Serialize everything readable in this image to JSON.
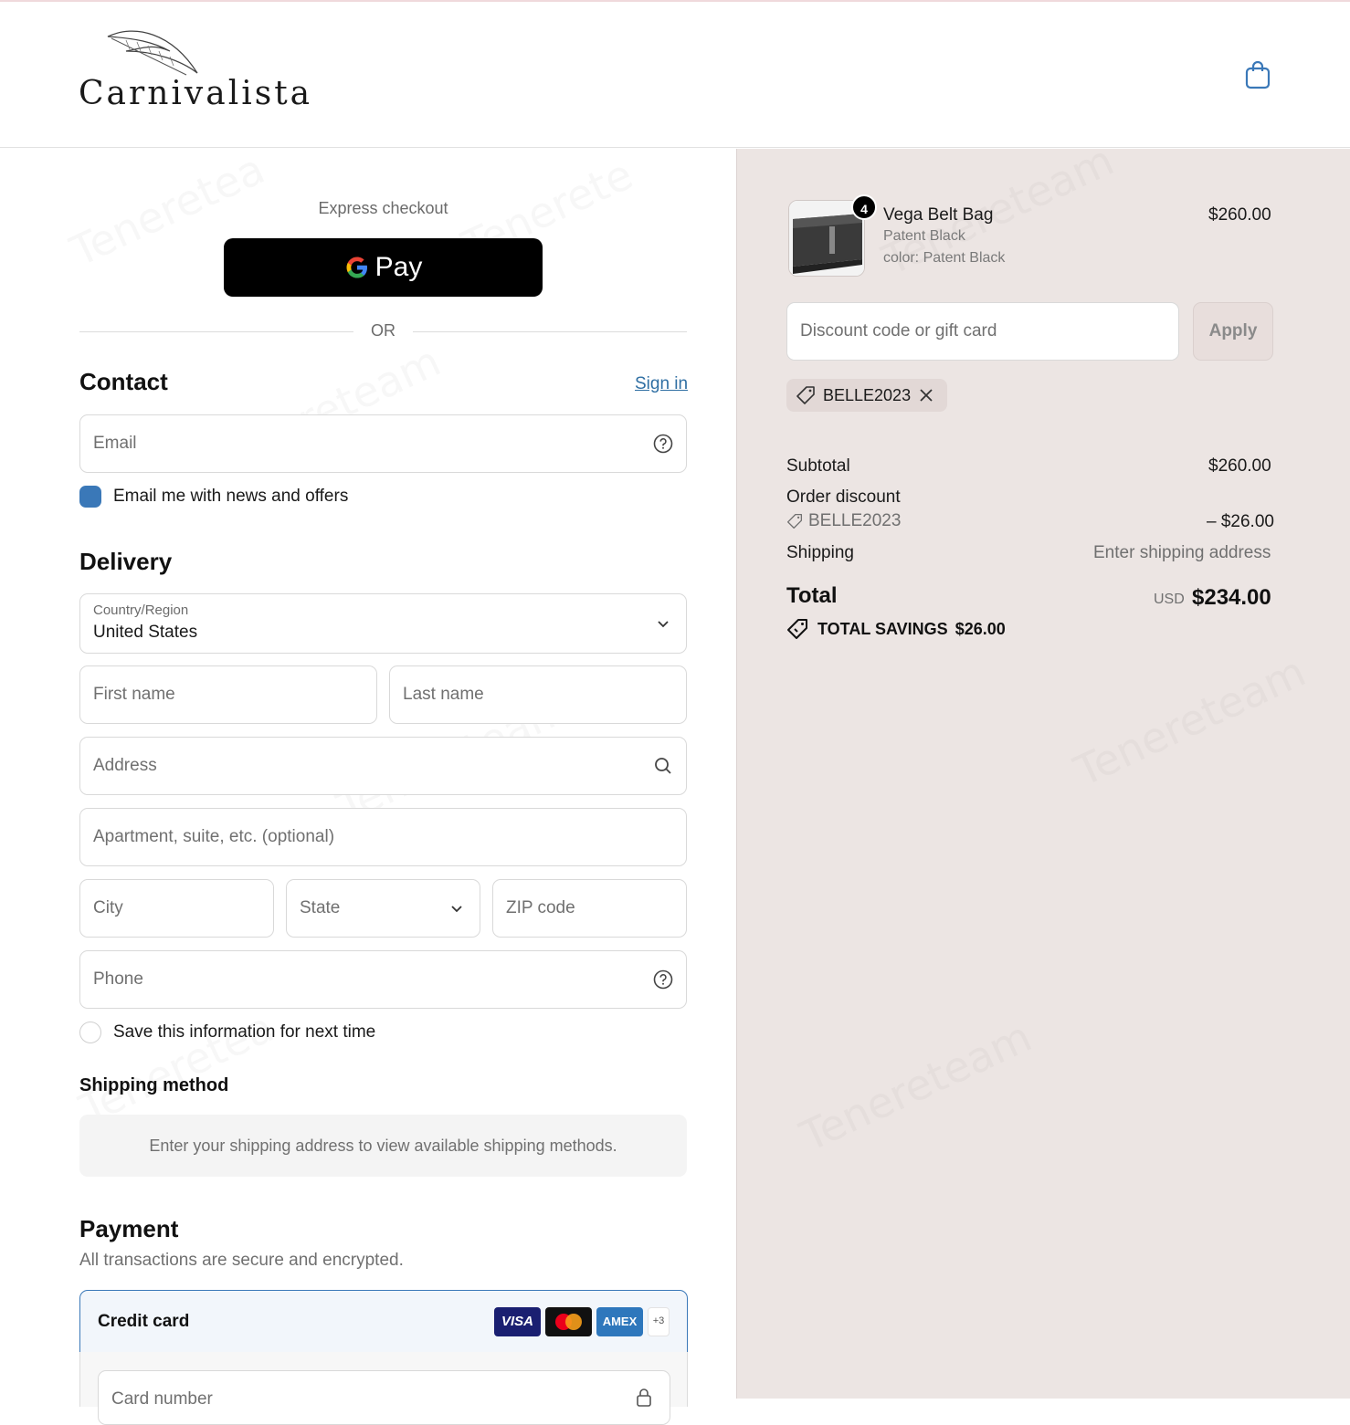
{
  "header": {
    "brand": "Carnivalista",
    "cart_icon": "shopping-bag-icon"
  },
  "checkout": {
    "express_label": "Express checkout",
    "gpay_label": "Pay",
    "or_label": "OR",
    "contact": {
      "title": "Contact",
      "sign_in": "Sign in",
      "email_placeholder": "Email",
      "news_label": "Email me with news and offers",
      "news_checked": true
    },
    "delivery": {
      "title": "Delivery",
      "country_label": "Country/Region",
      "country_value": "United States",
      "first_name": "First name",
      "last_name": "Last name",
      "address": "Address",
      "apartment": "Apartment, suite, etc. (optional)",
      "city": "City",
      "state": "State",
      "zip": "ZIP code",
      "phone": "Phone",
      "save_label": "Save this information for next time",
      "save_checked": false
    },
    "shipping_method": {
      "title": "Shipping method",
      "notice": "Enter your shipping address to view available shipping methods."
    },
    "payment": {
      "title": "Payment",
      "subtitle": "All transactions are secure and encrypted.",
      "credit_card_label": "Credit card",
      "cards": [
        "VISA",
        "Mastercard",
        "AMEX"
      ],
      "more_cards": "+3",
      "card_number_placeholder": "Card number"
    }
  },
  "summary": {
    "item": {
      "name": "Vega Belt Bag",
      "variant": "Patent Black",
      "option": "color: Patent Black",
      "price": "$260.00",
      "quantity": "4"
    },
    "discount_placeholder": "Discount code or gift card",
    "apply_label": "Apply",
    "applied_code": "BELLE2023",
    "subtotal_label": "Subtotal",
    "subtotal_value": "$260.00",
    "order_discount_label": "Order discount",
    "order_discount_code": "BELLE2023",
    "order_discount_value": "– $26.00",
    "shipping_label": "Shipping",
    "shipping_value": "Enter shipping address",
    "total_label": "Total",
    "currency": "USD",
    "total_value": "$234.00",
    "savings_label": "TOTAL SAVINGS",
    "savings_value": "$26.00"
  },
  "colors": {
    "accent": "#3a78b8",
    "summary_bg": "#ece5e3"
  }
}
